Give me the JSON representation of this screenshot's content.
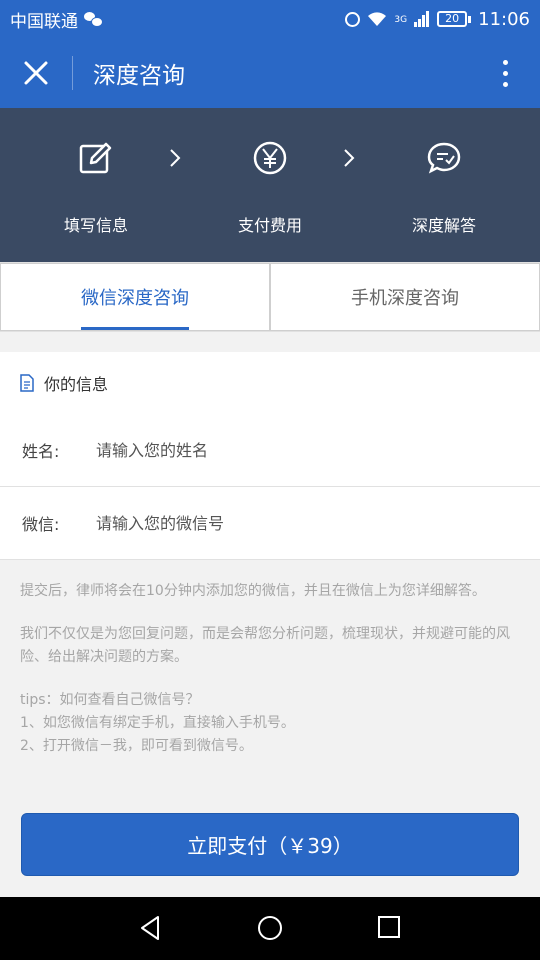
{
  "status_bar": {
    "carrier": "中国联通",
    "signal_label": "3G",
    "battery": "20",
    "time": "11:06"
  },
  "app_bar": {
    "title": "深度咨询",
    "close_icon": "close-icon",
    "more_icon": "more-vertical-icon"
  },
  "steps": [
    {
      "label": "填写信息",
      "icon": "edit-icon"
    },
    {
      "label": "支付费用",
      "icon": "yen-coin-icon"
    },
    {
      "label": "深度解答",
      "icon": "chat-check-icon"
    }
  ],
  "tabs": [
    {
      "label": "微信深度咨询",
      "active": true
    },
    {
      "label": "手机深度咨询",
      "active": false
    }
  ],
  "info": {
    "header": "你的信息",
    "fields": [
      {
        "label": "姓名:",
        "placeholder": "请输入您的姓名",
        "value": ""
      },
      {
        "label": "微信:",
        "placeholder": "请输入您的微信号",
        "value": ""
      }
    ]
  },
  "notes": {
    "p1": "提交后，律师将会在10分钟内添加您的微信，并且在微信上为您详细解答。",
    "p2": "我们不仅仅是为您回复问题，而是会帮您分析问题，梳理现状，并规避可能的风险、给出解决问题的方案。",
    "tips_title": "tips：如何查看自己微信号？",
    "tip1": "1、如您微信有绑定手机，直接输入手机号。",
    "tip2": "2、打开微信－我，即可看到微信号。"
  },
  "pay_button": "立即支付（￥39）",
  "colors": {
    "primary": "#2a68c6",
    "steps_bg": "#3a4a63",
    "note_text": "#a6a6a6"
  }
}
